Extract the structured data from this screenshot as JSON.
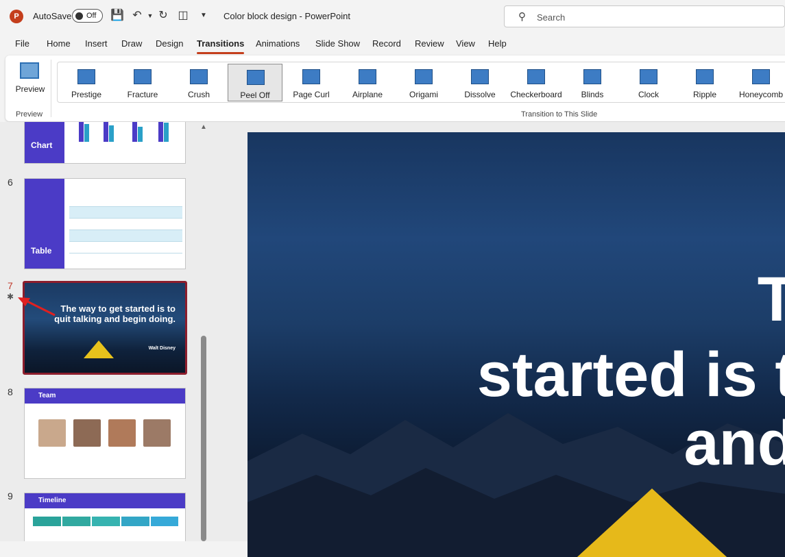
{
  "titlebar": {
    "logo_letter": "P",
    "autosave_label": "AutoSave",
    "autosave_state": "Off",
    "document_title": "Color block design  -  PowerPoint",
    "search_placeholder": "Search"
  },
  "menu": {
    "tabs": [
      "File",
      "Home",
      "Insert",
      "Draw",
      "Design",
      "Transitions",
      "Animations",
      "Slide Show",
      "Record",
      "Review",
      "View",
      "Help"
    ],
    "active": "Transitions"
  },
  "ribbon": {
    "preview_label": "Preview",
    "preview_group_label": "Preview",
    "transitions_group_label": "Transition to This Slide",
    "transitions": [
      "Prestige",
      "Fracture",
      "Crush",
      "Peel Off",
      "Page Curl",
      "Airplane",
      "Origami",
      "Dissolve",
      "Checkerboard",
      "Blinds",
      "Clock",
      "Ripple",
      "Honeycomb"
    ],
    "selected_transition": "Peel Off"
  },
  "thumbnails": {
    "slide5": {
      "title": "Chart"
    },
    "slide6": {
      "number": "6",
      "title": "Table"
    },
    "slide7": {
      "number": "7",
      "transition_marker": "✱",
      "quote": "The way to get started is to quit  talking and begin doing.",
      "author": "Walt Disney"
    },
    "slide8": {
      "number": "8",
      "title": "Team"
    },
    "slide9": {
      "number": "9",
      "title": "Timeline"
    }
  },
  "main_slide": {
    "line1": "T",
    "line2": "started is t",
    "line3": "and"
  },
  "colors": {
    "accent": "#c43e1c",
    "slide_purple": "#4b3bc6",
    "selected_slide_border": "#8c1d2c",
    "annotation_arrow": "#e02020",
    "transition_icon": "#3d7cc4"
  }
}
